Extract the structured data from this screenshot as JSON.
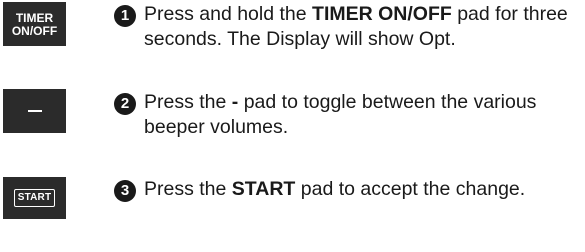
{
  "pads": {
    "timer_line1": "TIMER",
    "timer_line2": "ON/OFF",
    "minus_symbol": "–",
    "start": "START"
  },
  "steps": [
    {
      "number": "1",
      "pre": "Press and hold the ",
      "bold": "TIMER ON/OFF",
      "post": " pad for three seconds. The Display will show Opt."
    },
    {
      "number": "2",
      "pre": "Press the ",
      "bold": "-",
      "post": " pad to toggle between the various beeper volumes."
    },
    {
      "number": "3",
      "pre": "Press the ",
      "bold": "START",
      "post": " pad to accept the change."
    }
  ]
}
